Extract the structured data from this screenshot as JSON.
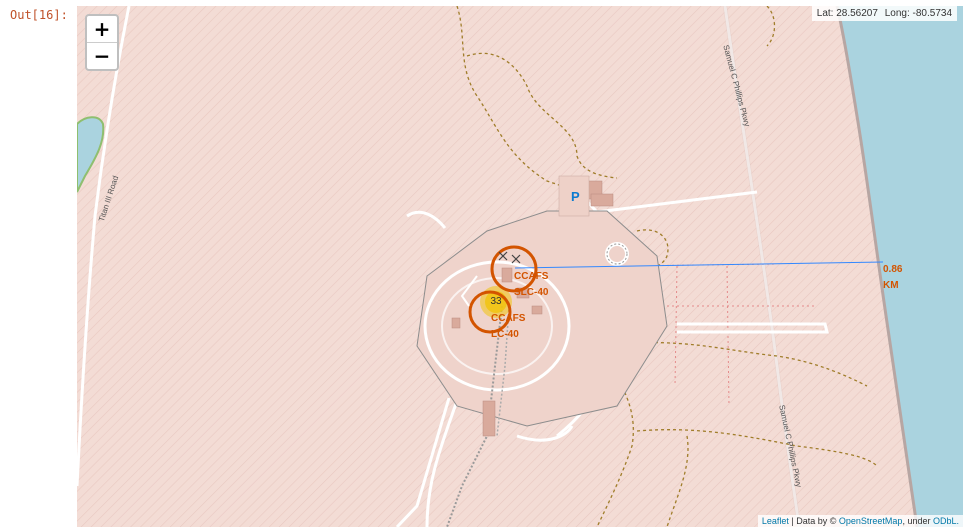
{
  "cell_prompt": "Out[16]:",
  "zoom": {
    "in_label": "+",
    "out_label": "−"
  },
  "mouse_position": {
    "lat": "Lat: 28.56207",
    "long": "Long: -80.5734"
  },
  "attribution": {
    "leaflet": "Leaflet",
    "sep": " | Data by © ",
    "osm": "OpenStreetMap",
    "under": ", under ",
    "odbl": "ODbL."
  },
  "roads": {
    "titan": "Titan III Road",
    "parkway_north": "Samuel C Phillips Pkwy",
    "parkway_south": "Samuel C Phillips Pkwy"
  },
  "markers": {
    "site_1": {
      "line1": "CCAFS",
      "line2": "SLC-40"
    },
    "site_2": {
      "line1": "CCAFS",
      "line2": "LC-40"
    },
    "cluster_count": "33",
    "distance": {
      "line1": "0.86",
      "line2": "KM"
    }
  },
  "parking_symbol": "P",
  "colors": {
    "land": "#f3dcd5",
    "water": "#aad3df",
    "marker": "#d35400",
    "distance_line": "#3388ff",
    "cluster": "#f1c40f",
    "track": "#a07d2a"
  }
}
